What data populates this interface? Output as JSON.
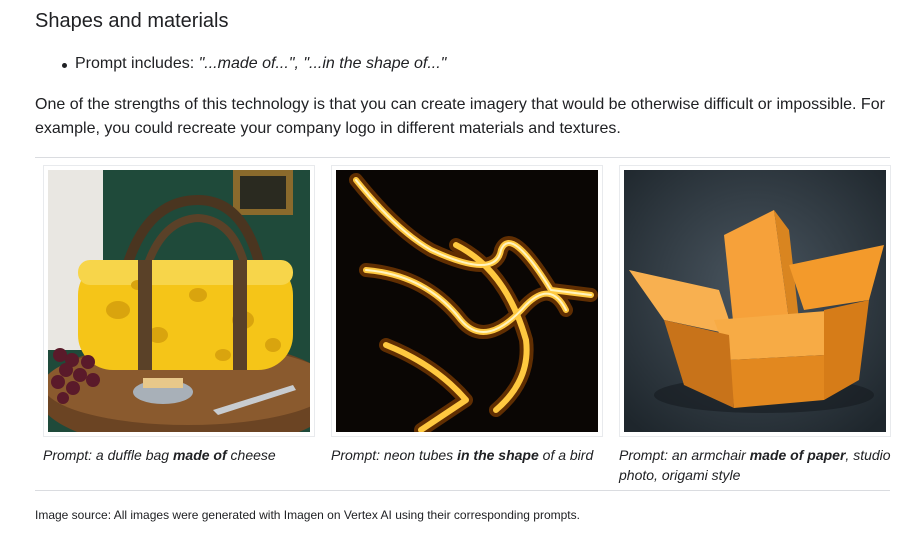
{
  "section": {
    "heading": "Shapes and materials",
    "bullet_prefix": "Prompt includes: ",
    "bullet_examples": "\"...made of...\", \"...in the shape of...\"",
    "intro": "One of the strengths of this technology is that you can create imagery that would be otherwise difficult or impossible. For example, you could recreate your company logo in different materials and textures."
  },
  "figures": [
    {
      "image": "duffle-bag-made-of-cheese",
      "caption_pre": "Prompt: a duffle bag ",
      "caption_bold": "made of",
      "caption_post": " cheese"
    },
    {
      "image": "neon-tubes-bird-shape",
      "caption_pre": "Prompt: neon tubes ",
      "caption_bold": "in the shape",
      "caption_post": " of a bird"
    },
    {
      "image": "paper-origami-armchair",
      "caption_pre": "Prompt: an armchair ",
      "caption_bold": "made of paper",
      "caption_post": ", studio photo, origami style"
    }
  ],
  "footer": {
    "source": "Image source: All images were generated with Imagen on Vertex AI using their corresponding prompts."
  },
  "colors": {
    "text": "#202124",
    "divider": "#dadce0",
    "cheese": "#f5c518",
    "neon": "#ffb000",
    "paper": "#f39a2b"
  }
}
